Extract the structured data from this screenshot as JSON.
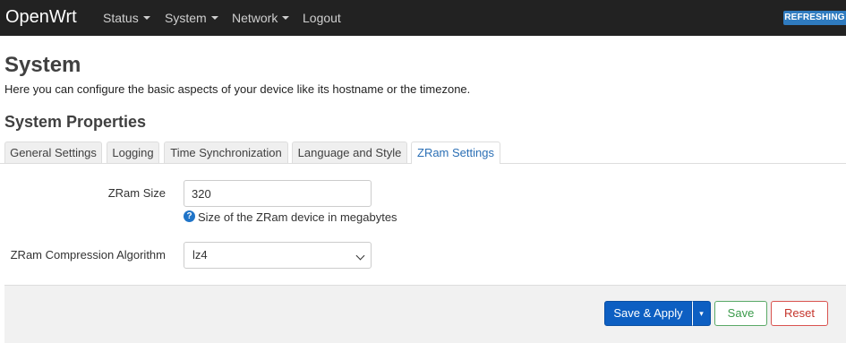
{
  "navbar": {
    "brand": "OpenWrt",
    "menu": [
      {
        "label": "Status",
        "has_dropdown": true
      },
      {
        "label": "System",
        "has_dropdown": true
      },
      {
        "label": "Network",
        "has_dropdown": true
      },
      {
        "label": "Logout",
        "has_dropdown": false
      }
    ],
    "status_badge": "REFRESHING"
  },
  "page": {
    "title": "System",
    "description": "Here you can configure the basic aspects of your device like its hostname or the timezone.",
    "section_title": "System Properties"
  },
  "tabs": [
    {
      "label": "General Settings",
      "active": false
    },
    {
      "label": "Logging",
      "active": false
    },
    {
      "label": "Time Synchronization",
      "active": false
    },
    {
      "label": "Language and Style",
      "active": false
    },
    {
      "label": "ZRam Settings",
      "active": true
    }
  ],
  "form": {
    "zram_size": {
      "label": "ZRam Size",
      "value": "320",
      "help": "Size of the ZRam device in megabytes"
    },
    "zram_algorithm": {
      "label": "ZRam Compression Algorithm",
      "selected": "lz4"
    }
  },
  "actions": {
    "save_apply": "Save & Apply",
    "save_apply_dropdown": "▾",
    "save": "Save",
    "reset": "Reset"
  },
  "icons": {
    "help": "question-circle-icon",
    "dropdown": "caret-down-icon"
  },
  "colors": {
    "navbar_bg": "#222222",
    "accent": "#0d5fc2",
    "badge": "#2f7bbf",
    "save_green": "#3a9a4a",
    "reset_red": "#c5342b"
  }
}
